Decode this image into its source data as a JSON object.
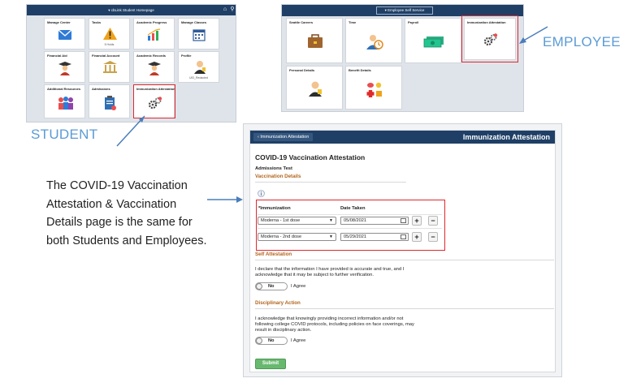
{
  "student": {
    "label": "STUDENT",
    "header_title": "▾ cbLink Student Homepage",
    "tiles": [
      {
        "title": "Manage Center",
        "sub": "",
        "icon": "envelope-icon"
      },
      {
        "title": "Tasks",
        "sub": "5 Holds",
        "icon": "warning-icon"
      },
      {
        "title": "Academic Progress",
        "sub": "",
        "icon": "chart-icon"
      },
      {
        "title": "Manage Classes",
        "sub": "",
        "icon": "calendar-icon"
      },
      {
        "title": "Financial Aid",
        "sub": "",
        "icon": "graduate-icon"
      },
      {
        "title": "Financial Account",
        "sub": "",
        "icon": "bank-icon"
      },
      {
        "title": "Academic Records",
        "sub": "",
        "icon": "graduate-icon"
      },
      {
        "title": "Profile",
        "sub": "UID_Redacted",
        "icon": "profile-icon"
      },
      {
        "title": "Additional Resources",
        "sub": "",
        "icon": "people-icon"
      },
      {
        "title": "Admissions",
        "sub": "",
        "icon": "clipboard-icon"
      },
      {
        "title": "Immunization Attestation",
        "sub": "",
        "icon": "gears-icon"
      }
    ]
  },
  "employee": {
    "label": "EMPLOYEE",
    "header_title": "▾ Employee Self Service",
    "tiles": [
      {
        "title": "Seattle Careers",
        "icon": "briefcase-icon"
      },
      {
        "title": "Time",
        "icon": "person-clock-icon"
      },
      {
        "title": "Payroll",
        "icon": "money-icon"
      },
      {
        "title": "Immunization Attestation",
        "icon": "gears-icon"
      },
      {
        "title": "Personal Details",
        "icon": "person-icon"
      },
      {
        "title": "Benefit Details",
        "icon": "benefits-icon"
      }
    ]
  },
  "caption": {
    "lines": [
      "The COVID-19 Vaccination",
      "Attestation & Vaccination",
      "Details page is the same for",
      "both Students and Employees."
    ]
  },
  "form": {
    "back_label": "‹  Immunization Attestation",
    "header_title": "Immunization Attestation",
    "page_title": "COVID-19 Vaccination Attestation",
    "subtitle": "Admissions Test",
    "vaccination_section": "Vaccination Details",
    "col_immunization": "*Immunization",
    "col_date": "Date Taken",
    "rows": [
      {
        "immunization": "Moderna - 1st dose",
        "date": "05/08/2021"
      },
      {
        "immunization": "Moderna - 2nd dose",
        "date": "05/29/2021"
      }
    ],
    "self_section": "Self Attestation",
    "self_text": [
      "I declare that the information I have provided is accurate and true, and I",
      "acknowledge that it may be subject to further verification."
    ],
    "disc_section": "Disciplinary Action",
    "disc_text": [
      "I acknowledge that knowingly providing incorrect information and/or not",
      "following college COVID protocols, including policies on face coverings, may",
      "result in disciplinary action."
    ],
    "toggle_value": "No",
    "agree_label": "I Agree",
    "submit_label": "Submit"
  }
}
